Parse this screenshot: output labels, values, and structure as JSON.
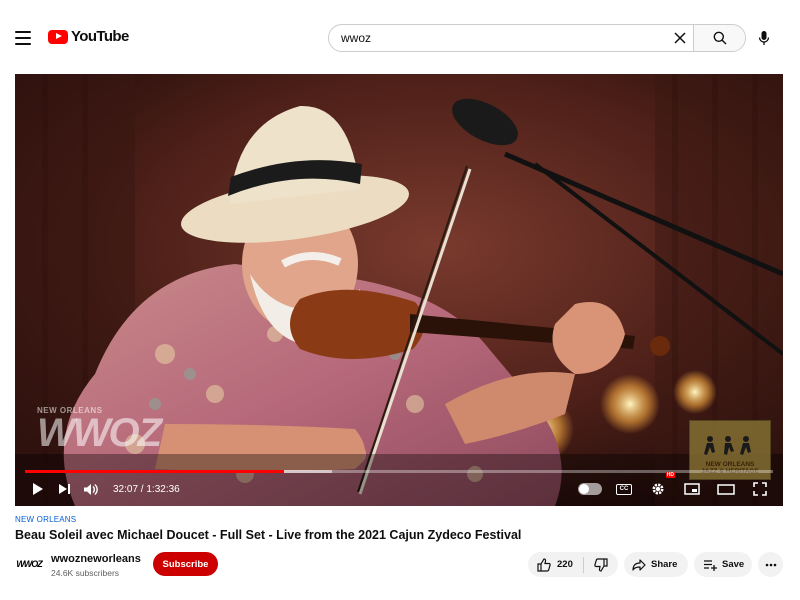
{
  "header": {
    "logo_text": "YouTube",
    "search_value": "wwoz"
  },
  "player": {
    "time_display": "32:07 / 1:32:36",
    "progress_fraction": 0.346,
    "watermark_small": "NEW ORLEANS",
    "watermark_big": "WWOZ",
    "festival_logo_lines": [
      "NEW ORLEANS",
      "JAZZ & HERITAGE"
    ],
    "hd_badge": "HD",
    "cc_label": "CC"
  },
  "video": {
    "tag": "NEW ORLEANS",
    "title": "Beau Soleil avec Michael Doucet - Full Set - Live from the 2021 Cajun Zydeco Festival"
  },
  "channel": {
    "avatar_text": "WWOZ",
    "name": "wwozneworleans",
    "subscribers": "24.6K subscribers",
    "subscribe_label": "Subscribe"
  },
  "actions": {
    "like_count": "220",
    "share_label": "Share",
    "save_label": "Save"
  },
  "colors": {
    "brand_red": "#ff0000",
    "subscribe_red": "#cc0000",
    "link_blue": "#065fd4"
  }
}
